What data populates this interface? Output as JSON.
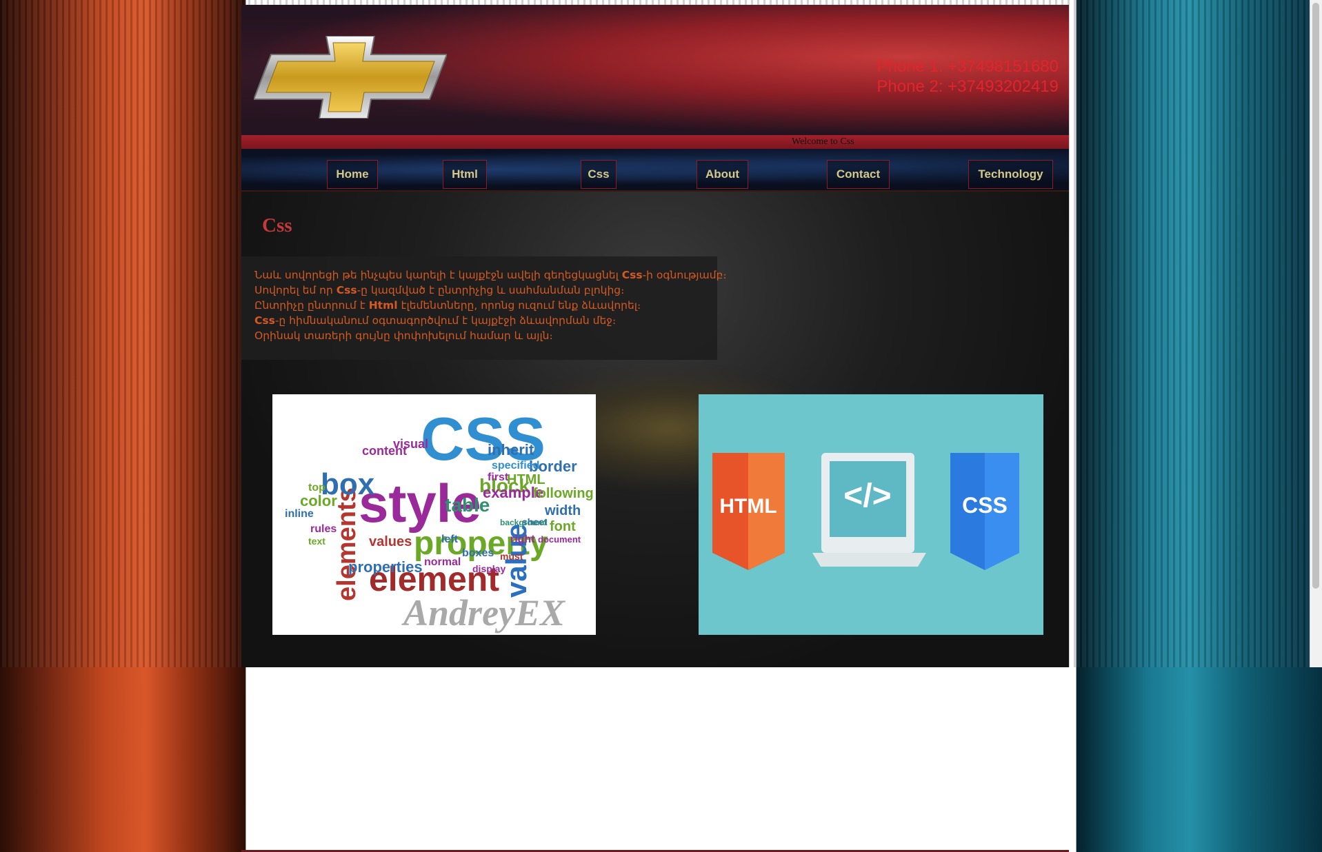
{
  "header": {
    "phones": [
      "Phone 1: +37498151680",
      "Phone 2: +37493202419"
    ],
    "welcome": "Welcome to Css",
    "logo_icon": "chevrolet-bowtie-logo"
  },
  "nav": {
    "items": [
      "Home",
      "Html",
      "Css",
      "About",
      "Contact",
      "Technology"
    ]
  },
  "content": {
    "title": "Css",
    "lines": [
      {
        "pre": "Նաև սովորեցի թե ինչպես կարելի է կայքէջն ավելի գեղեցկացնել ",
        "bold": "Css",
        "post": "-ի օգնությամբ։"
      },
      {
        "pre": "Սովորել եմ որ ",
        "bold": "Css",
        "post": "-ը կազմված է ընտրիչից և սահմանման բլոկից։"
      },
      {
        "pre": "Ընտրիչը ընտրում է ",
        "bold": "Html",
        "post": " էլեմենտները, որոնց ուզում ենք ձևավորել։"
      },
      {
        "pre": "",
        "bold": "Css",
        "post": "-ը հիմնականում օգտագործվում է կայքէջի ձևավորման մեջ։"
      },
      {
        "pre": "Օրինակ տառերի գույնը փոփոխելում համար և այլն։",
        "bold": "",
        "post": ""
      }
    ],
    "images": {
      "wordcloud": {
        "words": [
          "CSS",
          "style",
          "property",
          "element",
          "elements",
          "box",
          "value",
          "table",
          "block",
          "border",
          "inherit",
          "visual",
          "content",
          "example",
          "following",
          "width",
          "font",
          "color",
          "values",
          "properties",
          "normal",
          "left",
          "right",
          "rules",
          "inline",
          "text",
          "top",
          "specified",
          "HTML",
          "first",
          "sheet",
          "document",
          "background",
          "boxes",
          "display",
          "must"
        ],
        "watermark": "AndreyEX"
      },
      "tech": {
        "html_label": "HTML",
        "code_label": "</>",
        "css_label": "CSS"
      }
    }
  },
  "colors": {
    "phone_text": "#e3242b",
    "nav_text": "#d5c98a",
    "title": "#c43a3a",
    "body_text": "#d45a22"
  }
}
